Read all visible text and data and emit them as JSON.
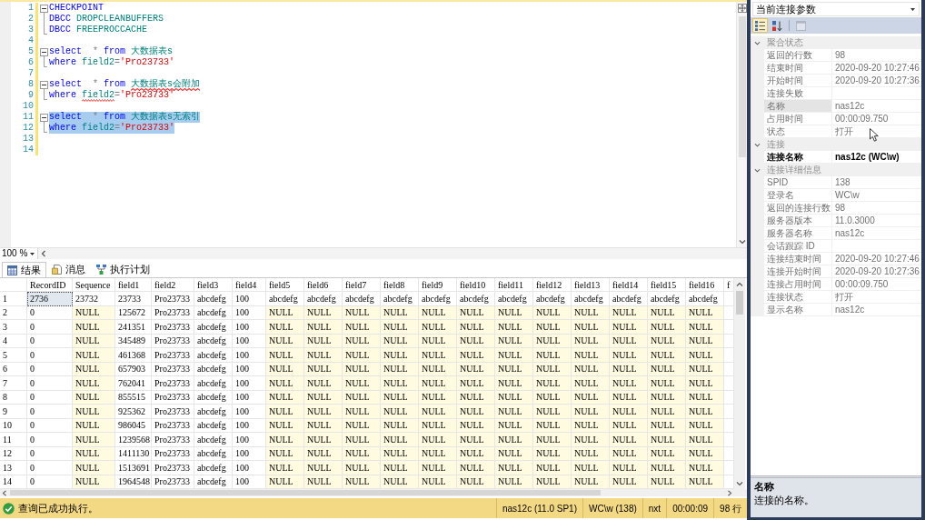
{
  "editor": {
    "zoom": "100 %",
    "lines": [
      {
        "number": "1",
        "modified": true,
        "selected": false,
        "kind": "fold-start",
        "tokens": [
          {
            "kind": "keyword",
            "text": "CHECKPOINT",
            "error": false
          }
        ]
      },
      {
        "number": "2",
        "modified": true,
        "selected": false,
        "kind": "fold-body",
        "tokens": [
          {
            "kind": "keyword",
            "text": "DBCC ",
            "error": false
          },
          {
            "kind": "identifier",
            "text": "DROPCLEANBUFFERS",
            "error": false
          }
        ]
      },
      {
        "number": "3",
        "modified": true,
        "selected": false,
        "kind": "fold-end",
        "tokens": [
          {
            "kind": "keyword",
            "text": "DBCC ",
            "error": false
          },
          {
            "kind": "identifier",
            "text": "FREEPROCCACHE",
            "error": false
          }
        ]
      },
      {
        "number": "4",
        "modified": true,
        "selected": false,
        "kind": "plain"
      },
      {
        "number": "5",
        "modified": true,
        "selected": false,
        "kind": "fold-start",
        "tokens": [
          {
            "kind": "keyword",
            "text": "select  ",
            "error": false
          },
          {
            "kind": "operator",
            "text": "* ",
            "error": false
          },
          {
            "kind": "keyword",
            "text": "from ",
            "error": false
          },
          {
            "kind": "identifier",
            "text": "大数据表s",
            "error": false
          }
        ]
      },
      {
        "number": "6",
        "modified": true,
        "selected": false,
        "kind": "fold-end",
        "tokens": [
          {
            "kind": "keyword",
            "text": "where ",
            "error": false
          },
          {
            "kind": "identifier",
            "text": "field2",
            "error": false
          },
          {
            "kind": "operator",
            "text": "=",
            "error": false
          },
          {
            "kind": "string",
            "text": "'Pro23733'",
            "error": false
          }
        ]
      },
      {
        "number": "7",
        "modified": true,
        "selected": false,
        "kind": "plain"
      },
      {
        "number": "8",
        "modified": true,
        "selected": false,
        "kind": "fold-start",
        "tokens": [
          {
            "kind": "keyword",
            "text": "select  ",
            "error": false
          },
          {
            "kind": "operator",
            "text": "* ",
            "error": false
          },
          {
            "kind": "keyword",
            "text": "from ",
            "error": false
          },
          {
            "kind": "identifier",
            "text": "大数据表s会附加",
            "error": true
          }
        ]
      },
      {
        "number": "9",
        "modified": true,
        "selected": false,
        "kind": "fold-end",
        "tokens": [
          {
            "kind": "keyword",
            "text": "where ",
            "error": false
          },
          {
            "kind": "identifier",
            "text": "field2",
            "error": true
          },
          {
            "kind": "operator",
            "text": "=",
            "error": false
          },
          {
            "kind": "string",
            "text": "'Pro23733'",
            "error": false
          }
        ]
      },
      {
        "number": "10",
        "modified": true,
        "selected": false,
        "kind": "plain"
      },
      {
        "number": "11",
        "modified": true,
        "selected": true,
        "kind": "fold-start",
        "tokens": [
          {
            "kind": "keyword",
            "text": "select  ",
            "error": false
          },
          {
            "kind": "operator",
            "text": "* ",
            "error": false
          },
          {
            "kind": "keyword",
            "text": "from ",
            "error": false
          },
          {
            "kind": "identifier",
            "text": "大数据表s无索引",
            "error": false
          }
        ]
      },
      {
        "number": "12",
        "modified": true,
        "selected": true,
        "kind": "fold-end",
        "tokens": [
          {
            "kind": "keyword",
            "text": "where ",
            "error": false
          },
          {
            "kind": "identifier",
            "text": "field2",
            "error": false
          },
          {
            "kind": "operator",
            "text": "=",
            "error": false
          },
          {
            "kind": "string",
            "text": "'Pro23733'",
            "error": false
          }
        ]
      },
      {
        "number": "13",
        "modified": true,
        "selected": false,
        "kind": "plain"
      },
      {
        "number": "14",
        "modified": true,
        "selected": false,
        "kind": "plain"
      }
    ]
  },
  "results": {
    "tabs": [
      {
        "label": "结果",
        "kind": "grid",
        "selected": true
      },
      {
        "label": "消息",
        "kind": "messages",
        "selected": false
      },
      {
        "label": "执行计划",
        "kind": "plan",
        "selected": false
      }
    ],
    "columns": [
      "RecordID",
      "Sequence",
      "field1",
      "field2",
      "field3",
      "field4",
      "field5",
      "field6",
      "field7",
      "field8",
      "field9",
      "field10",
      "field11",
      "field12",
      "field13",
      "field14",
      "field15",
      "field16",
      "f"
    ],
    "rows": [
      {
        "number": "1",
        "cells": [
          {
            "kind": "current",
            "text": "2736"
          },
          {
            "kind": "value",
            "text": "23732"
          },
          {
            "kind": "value",
            "text": "23733"
          },
          {
            "kind": "value",
            "text": "Pro23733"
          },
          {
            "kind": "value",
            "text": "abcdefg"
          },
          {
            "kind": "value",
            "text": "100"
          },
          {
            "kind": "value",
            "text": "abcdefg"
          },
          {
            "kind": "value",
            "text": "abcdefg"
          },
          {
            "kind": "value",
            "text": "abcdefg"
          },
          {
            "kind": "value",
            "text": "abcdefg"
          },
          {
            "kind": "value",
            "text": "abcdefg"
          },
          {
            "kind": "value",
            "text": "abcdefg"
          },
          {
            "kind": "value",
            "text": "abcdefg"
          },
          {
            "kind": "value",
            "text": "abcdefg"
          },
          {
            "kind": "value",
            "text": "abcdefg"
          },
          {
            "kind": "value",
            "text": "abcdefg"
          },
          {
            "kind": "value",
            "text": "abcdefg"
          },
          {
            "kind": "value",
            "text": "abcdefg"
          }
        ]
      },
      {
        "number": "2",
        "cells": [
          {
            "kind": "value",
            "text": "0"
          },
          {
            "kind": "null",
            "text": "NULL"
          },
          {
            "kind": "value",
            "text": "125672"
          },
          {
            "kind": "value",
            "text": "Pro23733"
          },
          {
            "kind": "value",
            "text": "abcdefg"
          },
          {
            "kind": "value",
            "text": "100"
          },
          {
            "kind": "null",
            "text": "NULL"
          },
          {
            "kind": "null",
            "text": "NULL"
          },
          {
            "kind": "null",
            "text": "NULL"
          },
          {
            "kind": "null",
            "text": "NULL"
          },
          {
            "kind": "null",
            "text": "NULL"
          },
          {
            "kind": "null",
            "text": "NULL"
          },
          {
            "kind": "null",
            "text": "NULL"
          },
          {
            "kind": "null",
            "text": "NULL"
          },
          {
            "kind": "null",
            "text": "NULL"
          },
          {
            "kind": "null",
            "text": "NULL"
          },
          {
            "kind": "null",
            "text": "NULL"
          },
          {
            "kind": "null",
            "text": "NULL"
          }
        ]
      },
      {
        "number": "3",
        "cells": [
          {
            "kind": "value",
            "text": "0"
          },
          {
            "kind": "null",
            "text": "NULL"
          },
          {
            "kind": "value",
            "text": "241351"
          },
          {
            "kind": "value",
            "text": "Pro23733"
          },
          {
            "kind": "value",
            "text": "abcdefg"
          },
          {
            "kind": "value",
            "text": "100"
          },
          {
            "kind": "null",
            "text": "NULL"
          },
          {
            "kind": "null",
            "text": "NULL"
          },
          {
            "kind": "null",
            "text": "NULL"
          },
          {
            "kind": "null",
            "text": "NULL"
          },
          {
            "kind": "null",
            "text": "NULL"
          },
          {
            "kind": "null",
            "text": "NULL"
          },
          {
            "kind": "null",
            "text": "NULL"
          },
          {
            "kind": "null",
            "text": "NULL"
          },
          {
            "kind": "null",
            "text": "NULL"
          },
          {
            "kind": "null",
            "text": "NULL"
          },
          {
            "kind": "null",
            "text": "NULL"
          },
          {
            "kind": "null",
            "text": "NULL"
          }
        ]
      },
      {
        "number": "4",
        "cells": [
          {
            "kind": "value",
            "text": "0"
          },
          {
            "kind": "null",
            "text": "NULL"
          },
          {
            "kind": "value",
            "text": "345489"
          },
          {
            "kind": "value",
            "text": "Pro23733"
          },
          {
            "kind": "value",
            "text": "abcdefg"
          },
          {
            "kind": "value",
            "text": "100"
          },
          {
            "kind": "null",
            "text": "NULL"
          },
          {
            "kind": "null",
            "text": "NULL"
          },
          {
            "kind": "null",
            "text": "NULL"
          },
          {
            "kind": "null",
            "text": "NULL"
          },
          {
            "kind": "null",
            "text": "NULL"
          },
          {
            "kind": "null",
            "text": "NULL"
          },
          {
            "kind": "null",
            "text": "NULL"
          },
          {
            "kind": "null",
            "text": "NULL"
          },
          {
            "kind": "null",
            "text": "NULL"
          },
          {
            "kind": "null",
            "text": "NULL"
          },
          {
            "kind": "null",
            "text": "NULL"
          },
          {
            "kind": "null",
            "text": "NULL"
          }
        ]
      },
      {
        "number": "5",
        "cells": [
          {
            "kind": "value",
            "text": "0"
          },
          {
            "kind": "null",
            "text": "NULL"
          },
          {
            "kind": "value",
            "text": "461368"
          },
          {
            "kind": "value",
            "text": "Pro23733"
          },
          {
            "kind": "value",
            "text": "abcdefg"
          },
          {
            "kind": "value",
            "text": "100"
          },
          {
            "kind": "null",
            "text": "NULL"
          },
          {
            "kind": "null",
            "text": "NULL"
          },
          {
            "kind": "null",
            "text": "NULL"
          },
          {
            "kind": "null",
            "text": "NULL"
          },
          {
            "kind": "null",
            "text": "NULL"
          },
          {
            "kind": "null",
            "text": "NULL"
          },
          {
            "kind": "null",
            "text": "NULL"
          },
          {
            "kind": "null",
            "text": "NULL"
          },
          {
            "kind": "null",
            "text": "NULL"
          },
          {
            "kind": "null",
            "text": "NULL"
          },
          {
            "kind": "null",
            "text": "NULL"
          },
          {
            "kind": "null",
            "text": "NULL"
          }
        ]
      },
      {
        "number": "6",
        "cells": [
          {
            "kind": "value",
            "text": "0"
          },
          {
            "kind": "null",
            "text": "NULL"
          },
          {
            "kind": "value",
            "text": "657903"
          },
          {
            "kind": "value",
            "text": "Pro23733"
          },
          {
            "kind": "value",
            "text": "abcdefg"
          },
          {
            "kind": "value",
            "text": "100"
          },
          {
            "kind": "null",
            "text": "NULL"
          },
          {
            "kind": "null",
            "text": "NULL"
          },
          {
            "kind": "null",
            "text": "NULL"
          },
          {
            "kind": "null",
            "text": "NULL"
          },
          {
            "kind": "null",
            "text": "NULL"
          },
          {
            "kind": "null",
            "text": "NULL"
          },
          {
            "kind": "null",
            "text": "NULL"
          },
          {
            "kind": "null",
            "text": "NULL"
          },
          {
            "kind": "null",
            "text": "NULL"
          },
          {
            "kind": "null",
            "text": "NULL"
          },
          {
            "kind": "null",
            "text": "NULL"
          },
          {
            "kind": "null",
            "text": "NULL"
          }
        ]
      },
      {
        "number": "7",
        "cells": [
          {
            "kind": "value",
            "text": "0"
          },
          {
            "kind": "null",
            "text": "NULL"
          },
          {
            "kind": "value",
            "text": "762041"
          },
          {
            "kind": "value",
            "text": "Pro23733"
          },
          {
            "kind": "value",
            "text": "abcdefg"
          },
          {
            "kind": "value",
            "text": "100"
          },
          {
            "kind": "null",
            "text": "NULL"
          },
          {
            "kind": "null",
            "text": "NULL"
          },
          {
            "kind": "null",
            "text": "NULL"
          },
          {
            "kind": "null",
            "text": "NULL"
          },
          {
            "kind": "null",
            "text": "NULL"
          },
          {
            "kind": "null",
            "text": "NULL"
          },
          {
            "kind": "null",
            "text": "NULL"
          },
          {
            "kind": "null",
            "text": "NULL"
          },
          {
            "kind": "null",
            "text": "NULL"
          },
          {
            "kind": "null",
            "text": "NULL"
          },
          {
            "kind": "null",
            "text": "NULL"
          },
          {
            "kind": "null",
            "text": "NULL"
          }
        ]
      },
      {
        "number": "8",
        "cells": [
          {
            "kind": "value",
            "text": "0"
          },
          {
            "kind": "null",
            "text": "NULL"
          },
          {
            "kind": "value",
            "text": "855515"
          },
          {
            "kind": "value",
            "text": "Pro23733"
          },
          {
            "kind": "value",
            "text": "abcdefg"
          },
          {
            "kind": "value",
            "text": "100"
          },
          {
            "kind": "null",
            "text": "NULL"
          },
          {
            "kind": "null",
            "text": "NULL"
          },
          {
            "kind": "null",
            "text": "NULL"
          },
          {
            "kind": "null",
            "text": "NULL"
          },
          {
            "kind": "null",
            "text": "NULL"
          },
          {
            "kind": "null",
            "text": "NULL"
          },
          {
            "kind": "null",
            "text": "NULL"
          },
          {
            "kind": "null",
            "text": "NULL"
          },
          {
            "kind": "null",
            "text": "NULL"
          },
          {
            "kind": "null",
            "text": "NULL"
          },
          {
            "kind": "null",
            "text": "NULL"
          },
          {
            "kind": "null",
            "text": "NULL"
          }
        ]
      },
      {
        "number": "9",
        "cells": [
          {
            "kind": "value",
            "text": "0"
          },
          {
            "kind": "null",
            "text": "NULL"
          },
          {
            "kind": "value",
            "text": "925362"
          },
          {
            "kind": "value",
            "text": "Pro23733"
          },
          {
            "kind": "value",
            "text": "abcdefg"
          },
          {
            "kind": "value",
            "text": "100"
          },
          {
            "kind": "null",
            "text": "NULL"
          },
          {
            "kind": "null",
            "text": "NULL"
          },
          {
            "kind": "null",
            "text": "NULL"
          },
          {
            "kind": "null",
            "text": "NULL"
          },
          {
            "kind": "null",
            "text": "NULL"
          },
          {
            "kind": "null",
            "text": "NULL"
          },
          {
            "kind": "null",
            "text": "NULL"
          },
          {
            "kind": "null",
            "text": "NULL"
          },
          {
            "kind": "null",
            "text": "NULL"
          },
          {
            "kind": "null",
            "text": "NULL"
          },
          {
            "kind": "null",
            "text": "NULL"
          },
          {
            "kind": "null",
            "text": "NULL"
          }
        ]
      },
      {
        "number": "10",
        "cells": [
          {
            "kind": "value",
            "text": "0"
          },
          {
            "kind": "null",
            "text": "NULL"
          },
          {
            "kind": "value",
            "text": "986045"
          },
          {
            "kind": "value",
            "text": "Pro23733"
          },
          {
            "kind": "value",
            "text": "abcdefg"
          },
          {
            "kind": "value",
            "text": "100"
          },
          {
            "kind": "null",
            "text": "NULL"
          },
          {
            "kind": "null",
            "text": "NULL"
          },
          {
            "kind": "null",
            "text": "NULL"
          },
          {
            "kind": "null",
            "text": "NULL"
          },
          {
            "kind": "null",
            "text": "NULL"
          },
          {
            "kind": "null",
            "text": "NULL"
          },
          {
            "kind": "null",
            "text": "NULL"
          },
          {
            "kind": "null",
            "text": "NULL"
          },
          {
            "kind": "null",
            "text": "NULL"
          },
          {
            "kind": "null",
            "text": "NULL"
          },
          {
            "kind": "null",
            "text": "NULL"
          },
          {
            "kind": "null",
            "text": "NULL"
          }
        ]
      },
      {
        "number": "11",
        "cells": [
          {
            "kind": "value",
            "text": "0"
          },
          {
            "kind": "null",
            "text": "NULL"
          },
          {
            "kind": "value",
            "text": "1239568"
          },
          {
            "kind": "value",
            "text": "Pro23733"
          },
          {
            "kind": "value",
            "text": "abcdefg"
          },
          {
            "kind": "value",
            "text": "100"
          },
          {
            "kind": "null",
            "text": "NULL"
          },
          {
            "kind": "null",
            "text": "NULL"
          },
          {
            "kind": "null",
            "text": "NULL"
          },
          {
            "kind": "null",
            "text": "NULL"
          },
          {
            "kind": "null",
            "text": "NULL"
          },
          {
            "kind": "null",
            "text": "NULL"
          },
          {
            "kind": "null",
            "text": "NULL"
          },
          {
            "kind": "null",
            "text": "NULL"
          },
          {
            "kind": "null",
            "text": "NULL"
          },
          {
            "kind": "null",
            "text": "NULL"
          },
          {
            "kind": "null",
            "text": "NULL"
          },
          {
            "kind": "null",
            "text": "NULL"
          }
        ]
      },
      {
        "number": "12",
        "cells": [
          {
            "kind": "value",
            "text": "0"
          },
          {
            "kind": "null",
            "text": "NULL"
          },
          {
            "kind": "value",
            "text": "1411130"
          },
          {
            "kind": "value",
            "text": "Pro23733"
          },
          {
            "kind": "value",
            "text": "abcdefg"
          },
          {
            "kind": "value",
            "text": "100"
          },
          {
            "kind": "null",
            "text": "NULL"
          },
          {
            "kind": "null",
            "text": "NULL"
          },
          {
            "kind": "null",
            "text": "NULL"
          },
          {
            "kind": "null",
            "text": "NULL"
          },
          {
            "kind": "null",
            "text": "NULL"
          },
          {
            "kind": "null",
            "text": "NULL"
          },
          {
            "kind": "null",
            "text": "NULL"
          },
          {
            "kind": "null",
            "text": "NULL"
          },
          {
            "kind": "null",
            "text": "NULL"
          },
          {
            "kind": "null",
            "text": "NULL"
          },
          {
            "kind": "null",
            "text": "NULL"
          },
          {
            "kind": "null",
            "text": "NULL"
          }
        ]
      },
      {
        "number": "13",
        "cells": [
          {
            "kind": "value",
            "text": "0"
          },
          {
            "kind": "null",
            "text": "NULL"
          },
          {
            "kind": "value",
            "text": "1513691"
          },
          {
            "kind": "value",
            "text": "Pro23733"
          },
          {
            "kind": "value",
            "text": "abcdefg"
          },
          {
            "kind": "value",
            "text": "100"
          },
          {
            "kind": "null",
            "text": "NULL"
          },
          {
            "kind": "null",
            "text": "NULL"
          },
          {
            "kind": "null",
            "text": "NULL"
          },
          {
            "kind": "null",
            "text": "NULL"
          },
          {
            "kind": "null",
            "text": "NULL"
          },
          {
            "kind": "null",
            "text": "NULL"
          },
          {
            "kind": "null",
            "text": "NULL"
          },
          {
            "kind": "null",
            "text": "NULL"
          },
          {
            "kind": "null",
            "text": "NULL"
          },
          {
            "kind": "null",
            "text": "NULL"
          },
          {
            "kind": "null",
            "text": "NULL"
          },
          {
            "kind": "null",
            "text": "NULL"
          }
        ]
      },
      {
        "number": "14",
        "cells": [
          {
            "kind": "value",
            "text": "0"
          },
          {
            "kind": "null",
            "text": "NULL"
          },
          {
            "kind": "value",
            "text": "1964548"
          },
          {
            "kind": "value",
            "text": "Pro23733"
          },
          {
            "kind": "value",
            "text": "abcdefg"
          },
          {
            "kind": "value",
            "text": "100"
          },
          {
            "kind": "null",
            "text": "NULL"
          },
          {
            "kind": "null",
            "text": "NULL"
          },
          {
            "kind": "null",
            "text": "NULL"
          },
          {
            "kind": "null",
            "text": "NULL"
          },
          {
            "kind": "null",
            "text": "NULL"
          },
          {
            "kind": "null",
            "text": "NULL"
          },
          {
            "kind": "null",
            "text": "NULL"
          },
          {
            "kind": "null",
            "text": "NULL"
          },
          {
            "kind": "null",
            "text": "NULL"
          },
          {
            "kind": "null",
            "text": "NULL"
          },
          {
            "kind": "null",
            "text": "NULL"
          },
          {
            "kind": "null",
            "text": "NULL"
          }
        ]
      }
    ]
  },
  "status_bar": {
    "message": "查询已成功执行。",
    "segments": [
      "nas12c (11.0 SP1)",
      "WC\\w (138)",
      "nxt",
      "00:00:09",
      "98 行"
    ]
  },
  "properties": {
    "dropdown": "当前连接参数",
    "toolbar": [
      {
        "kind": "categorized",
        "selected": true,
        "disabled": false
      },
      {
        "kind": "alphabetical",
        "selected": false,
        "disabled": false
      },
      {
        "kind": "property-pages",
        "selected": false,
        "disabled": true
      }
    ],
    "categories": [
      {
        "name": "聚合状态",
        "expanded": true,
        "rows": [
          {
            "name": "返回的行数",
            "value": "98",
            "selected": false,
            "read_only": true
          },
          {
            "name": "结束时间",
            "value": "2020-09-20 10:27:46",
            "selected": false,
            "read_only": true
          },
          {
            "name": "开始时间",
            "value": "2020-09-20 10:27:36",
            "selected": false,
            "read_only": true
          },
          {
            "name": "连接失败",
            "selected": false,
            "read_only": true
          },
          {
            "name": "名称",
            "value": "nas12c",
            "selected": true,
            "read_only": true
          },
          {
            "name": "占用时间",
            "value": "00:00:09.750",
            "selected": false,
            "read_only": true
          },
          {
            "name": "状态",
            "value": "打开",
            "selected": false,
            "read_only": true
          }
        ]
      },
      {
        "name": "连接",
        "expanded": true,
        "rows": [
          {
            "name": "连接名称",
            "value": "nas12c (WC\\w)",
            "selected": false,
            "read_only": false
          }
        ]
      },
      {
        "name": "连接详细信息",
        "expanded": true,
        "rows": [
          {
            "name": "SPID",
            "value": "138",
            "selected": false,
            "read_only": true
          },
          {
            "name": "登录名",
            "value": "WC\\w",
            "selected": false,
            "read_only": true
          },
          {
            "name": "返回的连接行数",
            "value": "98",
            "selected": false,
            "read_only": true
          },
          {
            "name": "服务器版本",
            "value": "11.0.3000",
            "selected": false,
            "read_only": true
          },
          {
            "name": "服务器名称",
            "value": "nas12c",
            "selected": false,
            "read_only": true
          },
          {
            "name": "会话跟踪 ID",
            "selected": false,
            "read_only": true
          },
          {
            "name": "连接结束时间",
            "value": "2020-09-20 10:27:46",
            "selected": false,
            "read_only": true
          },
          {
            "name": "连接开始时间",
            "value": "2020-09-20 10:27:36",
            "selected": false,
            "read_only": true
          },
          {
            "name": "连接占用时间",
            "value": "00:00:09.750",
            "selected": false,
            "read_only": true
          },
          {
            "name": "连接状态",
            "value": "打开",
            "selected": false,
            "read_only": true
          },
          {
            "name": "显示名称",
            "value": "nas12c",
            "selected": false,
            "read_only": true
          }
        ]
      }
    ],
    "description": {
      "title": "名称",
      "text": "连接的名称。"
    }
  }
}
